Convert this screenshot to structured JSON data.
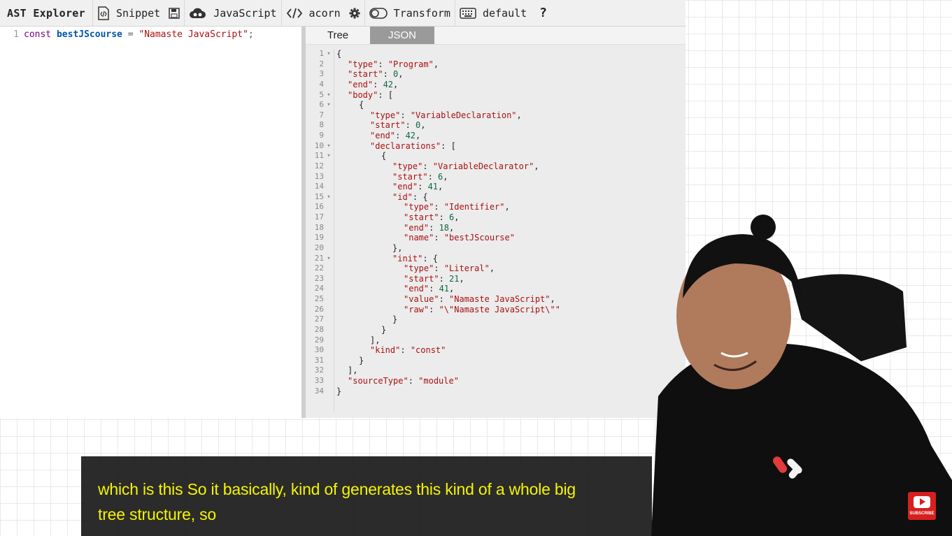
{
  "toolbar": {
    "brand": "AST Explorer",
    "snippet": "Snippet",
    "language": "JavaScript",
    "parser": "acorn",
    "transform": "Transform",
    "keymap": "default",
    "help": "?"
  },
  "editor": {
    "line_number": "1",
    "keyword": "const",
    "identifier": "bestJScourse",
    "operator": "=",
    "string": "\"Namaste JavaScript\"",
    "terminator": ";"
  },
  "output": {
    "tabs": [
      "Tree",
      "JSON"
    ],
    "active_tab": "JSON",
    "lines": [
      {
        "n": "1",
        "f": true,
        "i": 0,
        "t": [
          [
            "p",
            "{"
          ]
        ]
      },
      {
        "n": "2",
        "f": false,
        "i": 1,
        "t": [
          [
            "k",
            "\"type\""
          ],
          [
            "p",
            ": "
          ],
          [
            "s",
            "\"Program\""
          ],
          [
            "p",
            ","
          ]
        ]
      },
      {
        "n": "3",
        "f": false,
        "i": 1,
        "t": [
          [
            "k",
            "\"start\""
          ],
          [
            "p",
            ": "
          ],
          [
            "n",
            "0"
          ],
          [
            "p",
            ","
          ]
        ]
      },
      {
        "n": "4",
        "f": false,
        "i": 1,
        "t": [
          [
            "k",
            "\"end\""
          ],
          [
            "p",
            ": "
          ],
          [
            "n",
            "42"
          ],
          [
            "p",
            ","
          ]
        ]
      },
      {
        "n": "5",
        "f": true,
        "i": 1,
        "t": [
          [
            "k",
            "\"body\""
          ],
          [
            "p",
            ": ["
          ]
        ]
      },
      {
        "n": "6",
        "f": true,
        "i": 2,
        "t": [
          [
            "p",
            "{"
          ]
        ]
      },
      {
        "n": "7",
        "f": false,
        "i": 3,
        "t": [
          [
            "k",
            "\"type\""
          ],
          [
            "p",
            ": "
          ],
          [
            "s",
            "\"VariableDeclaration\""
          ],
          [
            "p",
            ","
          ]
        ]
      },
      {
        "n": "8",
        "f": false,
        "i": 3,
        "t": [
          [
            "k",
            "\"start\""
          ],
          [
            "p",
            ": "
          ],
          [
            "n",
            "0"
          ],
          [
            "p",
            ","
          ]
        ]
      },
      {
        "n": "9",
        "f": false,
        "i": 3,
        "t": [
          [
            "k",
            "\"end\""
          ],
          [
            "p",
            ": "
          ],
          [
            "n",
            "42"
          ],
          [
            "p",
            ","
          ]
        ]
      },
      {
        "n": "10",
        "f": true,
        "i": 3,
        "t": [
          [
            "k",
            "\"declarations\""
          ],
          [
            "p",
            ": ["
          ]
        ]
      },
      {
        "n": "11",
        "f": true,
        "i": 4,
        "t": [
          [
            "p",
            "{"
          ]
        ]
      },
      {
        "n": "12",
        "f": false,
        "i": 5,
        "t": [
          [
            "k",
            "\"type\""
          ],
          [
            "p",
            ": "
          ],
          [
            "s",
            "\"VariableDeclarator\""
          ],
          [
            "p",
            ","
          ]
        ]
      },
      {
        "n": "13",
        "f": false,
        "i": 5,
        "t": [
          [
            "k",
            "\"start\""
          ],
          [
            "p",
            ": "
          ],
          [
            "n",
            "6"
          ],
          [
            "p",
            ","
          ]
        ]
      },
      {
        "n": "14",
        "f": false,
        "i": 5,
        "t": [
          [
            "k",
            "\"end\""
          ],
          [
            "p",
            ": "
          ],
          [
            "n",
            "41"
          ],
          [
            "p",
            ","
          ]
        ]
      },
      {
        "n": "15",
        "f": true,
        "i": 5,
        "t": [
          [
            "k",
            "\"id\""
          ],
          [
            "p",
            ": {"
          ]
        ]
      },
      {
        "n": "16",
        "f": false,
        "i": 6,
        "t": [
          [
            "k",
            "\"type\""
          ],
          [
            "p",
            ": "
          ],
          [
            "s",
            "\"Identifier\""
          ],
          [
            "p",
            ","
          ]
        ]
      },
      {
        "n": "17",
        "f": false,
        "i": 6,
        "t": [
          [
            "k",
            "\"start\""
          ],
          [
            "p",
            ": "
          ],
          [
            "n",
            "6"
          ],
          [
            "p",
            ","
          ]
        ]
      },
      {
        "n": "18",
        "f": false,
        "i": 6,
        "t": [
          [
            "k",
            "\"end\""
          ],
          [
            "p",
            ": "
          ],
          [
            "n",
            "18"
          ],
          [
            "p",
            ","
          ]
        ]
      },
      {
        "n": "19",
        "f": false,
        "i": 6,
        "t": [
          [
            "k",
            "\"name\""
          ],
          [
            "p",
            ": "
          ],
          [
            "s",
            "\"bestJScourse\""
          ]
        ]
      },
      {
        "n": "20",
        "f": false,
        "i": 5,
        "t": [
          [
            "p",
            "},"
          ]
        ]
      },
      {
        "n": "21",
        "f": true,
        "i": 5,
        "t": [
          [
            "k",
            "\"init\""
          ],
          [
            "p",
            ": {"
          ]
        ]
      },
      {
        "n": "22",
        "f": false,
        "i": 6,
        "t": [
          [
            "k",
            "\"type\""
          ],
          [
            "p",
            ": "
          ],
          [
            "s",
            "\"Literal\""
          ],
          [
            "p",
            ","
          ]
        ]
      },
      {
        "n": "23",
        "f": false,
        "i": 6,
        "t": [
          [
            "k",
            "\"start\""
          ],
          [
            "p",
            ": "
          ],
          [
            "n",
            "21"
          ],
          [
            "p",
            ","
          ]
        ]
      },
      {
        "n": "24",
        "f": false,
        "i": 6,
        "t": [
          [
            "k",
            "\"end\""
          ],
          [
            "p",
            ": "
          ],
          [
            "n",
            "41"
          ],
          [
            "p",
            ","
          ]
        ]
      },
      {
        "n": "25",
        "f": false,
        "i": 6,
        "t": [
          [
            "k",
            "\"value\""
          ],
          [
            "p",
            ": "
          ],
          [
            "s",
            "\"Namaste JavaScript\""
          ],
          [
            "p",
            ","
          ]
        ]
      },
      {
        "n": "26",
        "f": false,
        "i": 6,
        "t": [
          [
            "k",
            "\"raw\""
          ],
          [
            "p",
            ": "
          ],
          [
            "s",
            "\"\\\"Namaste JavaScript\\\"\""
          ]
        ]
      },
      {
        "n": "27",
        "f": false,
        "i": 5,
        "t": [
          [
            "p",
            "}"
          ]
        ]
      },
      {
        "n": "28",
        "f": false,
        "i": 4,
        "t": [
          [
            "p",
            "}"
          ]
        ]
      },
      {
        "n": "29",
        "f": false,
        "i": 3,
        "t": [
          [
            "p",
            "],"
          ]
        ]
      },
      {
        "n": "30",
        "f": false,
        "i": 3,
        "t": [
          [
            "k",
            "\"kind\""
          ],
          [
            "p",
            ": "
          ],
          [
            "s",
            "\"const\""
          ]
        ]
      },
      {
        "n": "31",
        "f": false,
        "i": 2,
        "t": [
          [
            "p",
            "}"
          ]
        ]
      },
      {
        "n": "32",
        "f": false,
        "i": 1,
        "t": [
          [
            "p",
            "],"
          ]
        ]
      },
      {
        "n": "33",
        "f": false,
        "i": 1,
        "t": [
          [
            "k",
            "\"sourceType\""
          ],
          [
            "p",
            ": "
          ],
          [
            "s",
            "\"module\""
          ]
        ]
      },
      {
        "n": "34",
        "f": false,
        "i": 0,
        "t": [
          [
            "p",
            "}"
          ]
        ]
      }
    ]
  },
  "captions": {
    "line1": "which is this So it basically, kind of generates this kind of a whole big",
    "line2": "tree structure, so"
  },
  "subscribe": {
    "label": "SUBSCRIBE",
    "color": "#d71f1f"
  },
  "icons": [
    "snippet-icon",
    "save-icon",
    "parser-icon",
    "code-icon",
    "gear-icon",
    "toggle-icon",
    "keyboard-icon",
    "play-icon"
  ]
}
